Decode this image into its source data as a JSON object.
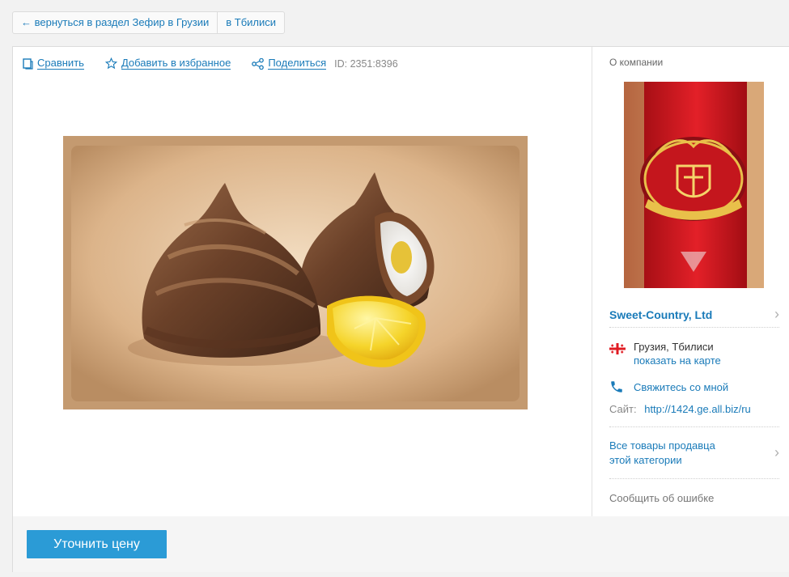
{
  "breadcrumbs": {
    "back": "← вернуться в раздел Зефир в Грузии",
    "city": "в Тбилиси"
  },
  "actions": {
    "compare": "Сравнить",
    "favorite": "Добавить в избранное",
    "share": "Поделиться",
    "id_text": "ID: 2351:8396"
  },
  "sidebar": {
    "about": "О компании",
    "company_name": "Sweet-Country, Ltd",
    "location": "Грузия, Тбилиси",
    "show_map": "показать на карте",
    "contact": "Свяжитесь со мной",
    "site_label": "Сайт:",
    "site_url": "http://1424.ge.all.biz/ru",
    "all_goods_line1": "Все товары продавца",
    "all_goods_line2": "этой категории",
    "report": "Сообщить об ошибке"
  },
  "footer": {
    "price_button": "Уточнить цену"
  },
  "colors": {
    "link": "#1a7bb9",
    "button": "#2b9bd6",
    "logo_red": "#d7191f"
  },
  "icons": [
    "compare-icon",
    "star-icon",
    "share-icon",
    "georgia-flag-icon",
    "phone-icon",
    "chevron-right-icon"
  ]
}
